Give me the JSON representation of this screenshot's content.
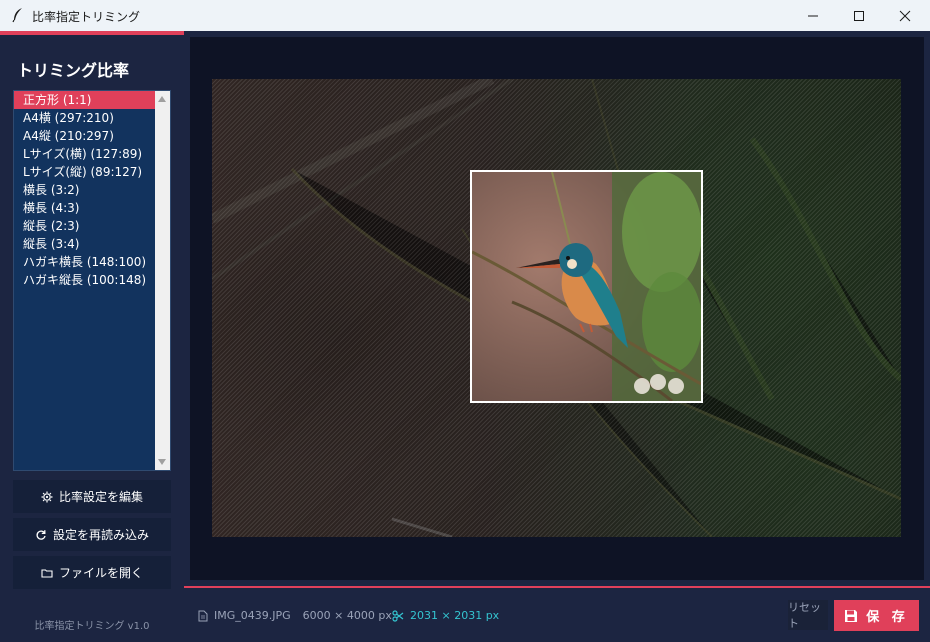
{
  "window": {
    "title": "比率指定トリミング",
    "minimize_icon": "minimize-icon",
    "maximize_icon": "maximize-icon",
    "close_icon": "close-icon"
  },
  "sidebar": {
    "heading": "トリミング比率",
    "ratios": [
      "正方形 (1:1)",
      "A4横 (297:210)",
      "A4縦 (210:297)",
      "Lサイズ(横) (127:89)",
      "Lサイズ(縦) (89:127)",
      "横長 (3:2)",
      "横長 (4:3)",
      "縦長 (2:3)",
      "縦長 (3:4)",
      "ハガキ横長 (148:100)",
      "ハガキ縦長 (100:148)"
    ],
    "selected_index": 0,
    "buttons": {
      "edit_settings": "比率設定を編集",
      "reload_settings": "設定を再読み込み",
      "open_file": "ファイルを開く"
    },
    "version": "比率指定トリミング v1.0"
  },
  "status": {
    "file_name": "IMG_0439.JPG",
    "image_size": "6000 × 4000 px",
    "crop_size": "2031 × 2031 px",
    "reset_label": "リセット",
    "save_label": "保 存"
  },
  "colors": {
    "accent": "#e0405a",
    "sidebar_bg": "#1c2541",
    "list_bg": "#12335e",
    "crop_info": "#34c4d0"
  }
}
